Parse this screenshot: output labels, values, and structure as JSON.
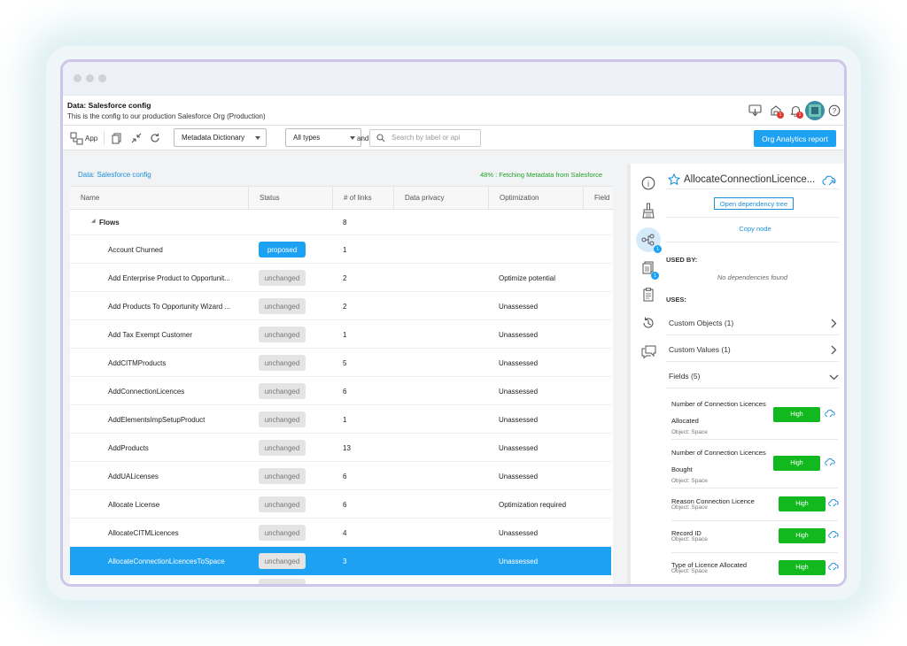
{
  "header": {
    "title": "Data: Salesforce config",
    "subtitle": "This is the config to our production Salesforce Org (Production)",
    "icons": [
      "download-icon",
      "org-notification-icon",
      "bell-icon",
      "avatar",
      "help-icon"
    ],
    "badge_org": "1",
    "badge_bell": "1",
    "help_glyph": "?"
  },
  "toolbar": {
    "app_label": "App",
    "dictionary_select": "Metadata Dictionary",
    "type_select": "All types",
    "and_label": "and",
    "search_placeholder": "Search by label or api",
    "report_button": "Org Analytics report"
  },
  "left_panel": {
    "breadcrumb": "Data: Salesforce config",
    "fetch_status": "48% : Fetching Metadata from Salesforce",
    "columns": [
      "Name",
      "Status",
      "# of links",
      "Data privacy",
      "Optimization",
      "Field"
    ],
    "group": {
      "name": "Flows",
      "links": "8"
    },
    "rows": [
      {
        "name": "Account Churned",
        "status": "proposed",
        "links": "1",
        "optimization": ""
      },
      {
        "name": "Add Enterprise Product to Opportunit...",
        "status": "unchanged",
        "links": "2",
        "optimization": "Optimize potential"
      },
      {
        "name": "Add Products To Opportunity Wizard ...",
        "status": "unchanged",
        "links": "2",
        "optimization": "Unassessed"
      },
      {
        "name": "Add Tax Exempt Customer",
        "status": "unchanged",
        "links": "1",
        "optimization": "Unassessed"
      },
      {
        "name": "AddCITMProducts",
        "status": "unchanged",
        "links": "5",
        "optimization": "Unassessed"
      },
      {
        "name": "AddConnectionLicences",
        "status": "unchanged",
        "links": "6",
        "optimization": "Unassessed"
      },
      {
        "name": "AddElementsImpSetupProduct",
        "status": "unchanged",
        "links": "1",
        "optimization": "Unassessed"
      },
      {
        "name": "AddProducts",
        "status": "unchanged",
        "links": "13",
        "optimization": "Unassessed"
      },
      {
        "name": "AddUALicenses",
        "status": "unchanged",
        "links": "6",
        "optimization": "Unassessed"
      },
      {
        "name": "Allocate License",
        "status": "unchanged",
        "links": "6",
        "optimization": "Optimization required"
      },
      {
        "name": "AllocateCITMLicences",
        "status": "unchanged",
        "links": "4",
        "optimization": "Unassessed"
      },
      {
        "name": "AllocateConnectionLicencesToSpace",
        "status": "unchanged",
        "links": "3",
        "optimization": "Unassessed"
      }
    ]
  },
  "side_icons": {
    "info_glyph": "i",
    "deps_badge": "1",
    "docs_badge": "1"
  },
  "right_panel": {
    "title": "AllocateConnectionLicence...",
    "open_tree_button": "Open dependency tree",
    "copy_node": "Copy node",
    "used_by_label": "USED BY:",
    "no_deps": "No dependencies found",
    "uses_label": "USES:",
    "sections": [
      {
        "label": "Custom Objects (1)",
        "expanded": false
      },
      {
        "label": "Custom Values (1)",
        "expanded": false
      },
      {
        "label": "Fields (5)",
        "expanded": true
      }
    ],
    "fields": [
      {
        "name": "Number of Connection Licences Allocated",
        "object": "Object: Space",
        "rating": "High"
      },
      {
        "name": "Number of Connection Licences Bought",
        "object": "Object: Space",
        "rating": "High"
      },
      {
        "name": "Reason Connection Licence",
        "object": "Object: Space",
        "rating": "High"
      },
      {
        "name": "Record ID",
        "object": "Object: Space",
        "rating": "High"
      },
      {
        "name": "Type of Licence Allocated",
        "object": "Object: Space",
        "rating": "High"
      }
    ]
  },
  "colors": {
    "accent": "#1da1f2",
    "success": "#11b81e",
    "link": "#1d8fd8",
    "badge": "#e0342d"
  }
}
